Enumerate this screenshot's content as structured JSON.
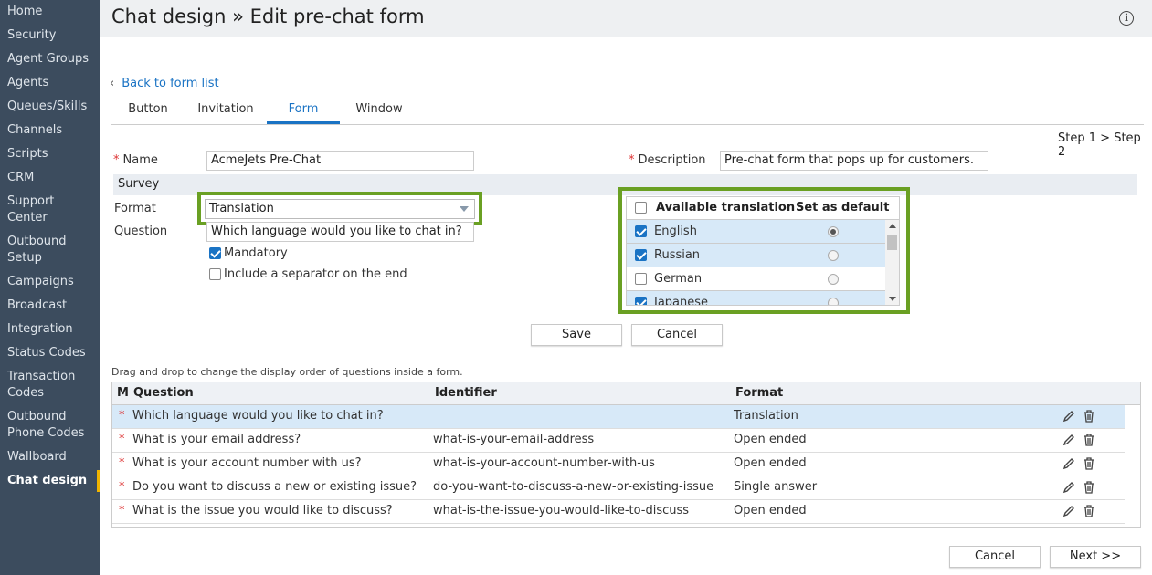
{
  "sidebar": {
    "items": [
      {
        "label": "Home"
      },
      {
        "label": "Security"
      },
      {
        "label": "Agent Groups"
      },
      {
        "label": "Agents"
      },
      {
        "label": "Queues/Skills"
      },
      {
        "label": "Channels"
      },
      {
        "label": "Scripts"
      },
      {
        "label": "CRM"
      },
      {
        "label": "Support Center"
      },
      {
        "label": "Outbound Setup"
      },
      {
        "label": "Campaigns"
      },
      {
        "label": "Broadcast"
      },
      {
        "label": "Integration"
      },
      {
        "label": "Status Codes"
      },
      {
        "label": "Transaction Codes"
      },
      {
        "label": "Outbound Phone Codes"
      },
      {
        "label": "Wallboard"
      },
      {
        "label": "Chat design"
      }
    ],
    "active_index": 17
  },
  "header": {
    "title": "Chat design » Edit pre-chat form",
    "info_icon": "i"
  },
  "back_link": "Back to form list",
  "tabs": [
    {
      "label": "Button"
    },
    {
      "label": "Invitation"
    },
    {
      "label": "Form"
    },
    {
      "label": "Window"
    }
  ],
  "active_tab": "Form",
  "steps": {
    "step1": "Step 1",
    "separator": ">",
    "step2": "Step 2"
  },
  "form": {
    "required_mark": "*",
    "name_label": "Name",
    "name_value": "AcmeJets Pre-Chat",
    "description_label": "Description",
    "description_value": "Pre-chat form that pops up for customers.",
    "survey_label": "Survey",
    "format_label": "Format",
    "format_value": "Translation",
    "question_label": "Question",
    "question_value": "Which language would you like to chat in?",
    "mandatory_label": "Mandatory",
    "mandatory_checked": true,
    "separator_label": "Include a separator on the end",
    "separator_checked": false
  },
  "translation_table": {
    "col_available": "Available translation",
    "col_default": "Set as default",
    "rows": [
      {
        "language": "English",
        "checked": true,
        "default": true
      },
      {
        "language": "Russian",
        "checked": true,
        "default": false
      },
      {
        "language": "German",
        "checked": false,
        "default": false
      },
      {
        "language": "Japanese",
        "checked": true,
        "default": false
      }
    ]
  },
  "buttons": {
    "save": "Save",
    "cancel": "Cancel",
    "bottom_cancel": "Cancel",
    "next": "Next >>"
  },
  "drag_hint": "Drag and drop to change the display order of questions inside a form.",
  "questions_table": {
    "headers": {
      "m": "M",
      "question": "Question",
      "identifier": "Identifier",
      "format": "Format"
    },
    "rows": [
      {
        "mandatory": "*",
        "question": "Which language would you like to chat in?",
        "identifier": "",
        "format": "Translation"
      },
      {
        "mandatory": "*",
        "question": "What is your email address?",
        "identifier": "what-is-your-email-address",
        "format": "Open ended"
      },
      {
        "mandatory": "*",
        "question": "What is your account number with us?",
        "identifier": "what-is-your-account-number-with-us",
        "format": "Open ended"
      },
      {
        "mandatory": "*",
        "question": "Do you want to discuss a new or existing issue?",
        "identifier": "do-you-want-to-discuss-a-new-or-existing-issue",
        "format": "Single answer"
      },
      {
        "mandatory": "*",
        "question": "What is the issue you would like to discuss?",
        "identifier": "what-is-the-issue-you-would-like-to-discuss",
        "format": "Open ended"
      }
    ]
  },
  "colors": {
    "sidebar_bg": "#3c4c5e",
    "accent": "#1a73c4",
    "highlight_box": "#6aa023",
    "selected_row": "#d7e9f8",
    "active_indicator": "#f0b400"
  }
}
